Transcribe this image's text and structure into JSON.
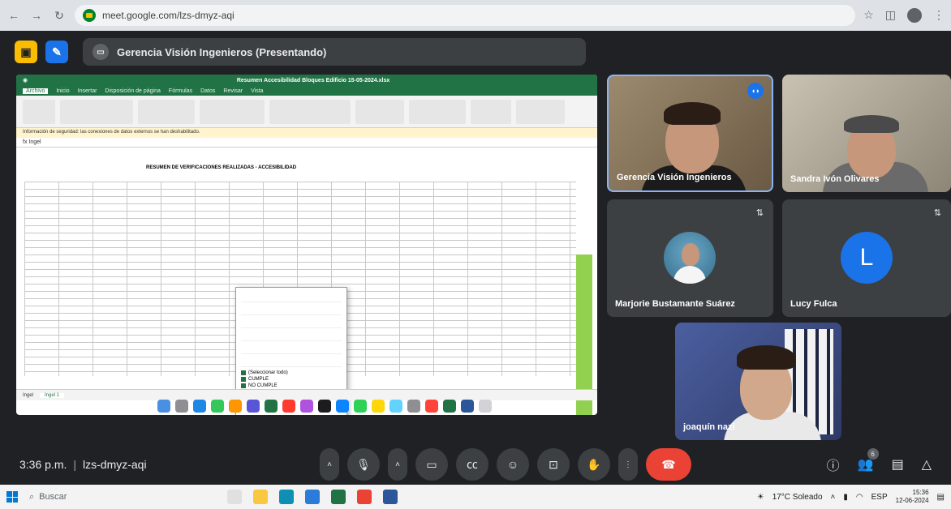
{
  "browser": {
    "url": "meet.google.com/lzs-dmyz-aqi",
    "nav": {
      "back": "←",
      "forward": "→",
      "reload": "↻"
    }
  },
  "meet_header": {
    "presenting_label": "Gerencia Visión Ingenieros (Presentando)"
  },
  "shared_screen": {
    "app_menu": [
      "Archivo",
      "Inicio",
      "Insertar",
      "Disposición de página",
      "Fórmulas",
      "Datos",
      "Revisar",
      "Vista"
    ],
    "doc_title": "Resumen Accesibilidad Bloques Edificio 15-05-2024.xlsx",
    "message_bar": "Información de seguridad: las conexiones de datos externos se han deshabilitado.",
    "formula_value": "fx  Ingel",
    "sheet_heading": "RESUMEN DE VERIFICACIONES REALIZADAS - ACCESIBILIDAD",
    "filter": {
      "options": [
        "(Seleccionar todo)",
        "CUMPLE",
        "NO CUMPLE"
      ]
    },
    "sheet_tabs": [
      "Ingel",
      "Ingel 1"
    ]
  },
  "participants": [
    {
      "name": "Gerencia Visión Ingenieros",
      "speaking": true
    },
    {
      "name": "Sandra Ivón Olivares"
    },
    {
      "name": "Marjorie Bustamante Suárez"
    },
    {
      "name": "Lucy Fulca",
      "initial": "L"
    },
    {
      "name": "joaquín nazi"
    }
  ],
  "meet_bottom": {
    "time": "3:36 p.m.",
    "separator": "|",
    "meeting_code": "lzs-dmyz-aqi",
    "people_count": "6"
  },
  "taskbar": {
    "search_placeholder": "Buscar",
    "weather": "17°C Soleado",
    "language": "ESP",
    "clock_time": "15:36",
    "clock_date": "12-06-2024"
  },
  "colors": {
    "meet_bg": "#202124",
    "tile_bg": "#3c4043",
    "hangup": "#ea4335",
    "excel_green": "#217346",
    "accent_blue": "#1a73e8"
  }
}
